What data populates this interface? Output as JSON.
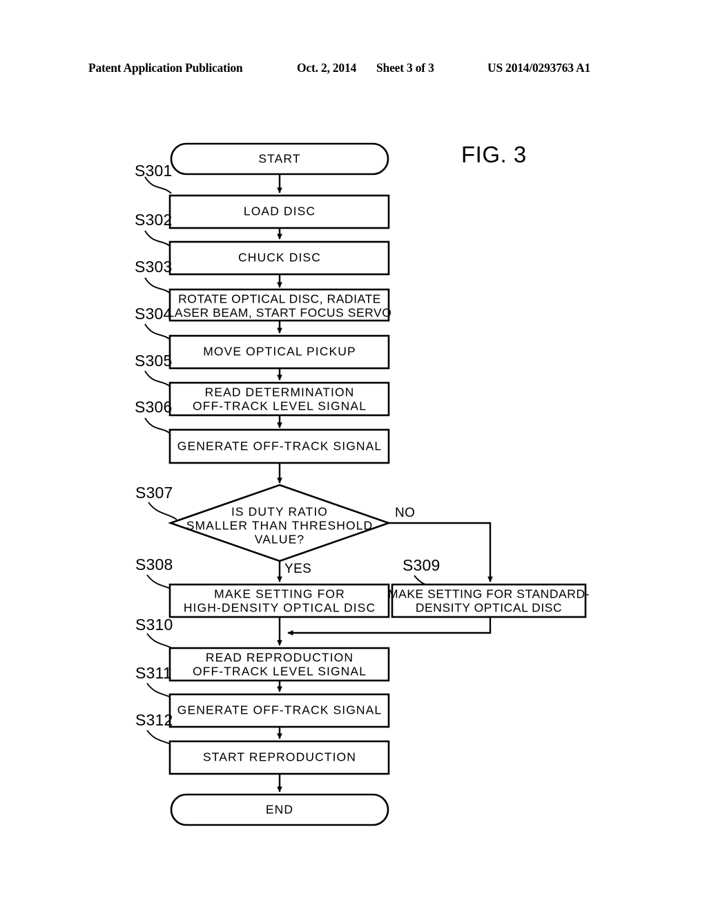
{
  "header": {
    "publication": "Patent Application Publication",
    "date": "Oct. 2, 2014",
    "sheet": "Sheet 3 of 3",
    "number": "US 2014/0293763 A1"
  },
  "figure": {
    "label": "FIG. 3"
  },
  "flowchart": {
    "nodes": [
      {
        "id": "S301",
        "step": "S301",
        "shape": "terminator",
        "lines": [
          "START"
        ]
      },
      {
        "id": "S302",
        "step": "S302",
        "shape": "process",
        "lines": [
          "LOAD DISC"
        ]
      },
      {
        "id": "S303",
        "step": "S303",
        "shape": "process",
        "lines": [
          "CHUCK  DISC"
        ]
      },
      {
        "id": "S304",
        "step": "S304",
        "shape": "process",
        "lines": [
          "ROTATE  OPTICAL  DISC,  RADIATE",
          "LASER  BEAM,  START  FOCUS  SERVO"
        ]
      },
      {
        "id": "S305",
        "step": "S305",
        "shape": "process",
        "lines": [
          "MOVE  OPTICAL  PICKUP"
        ]
      },
      {
        "id": "S306",
        "step": "S306",
        "shape": "process",
        "lines": [
          "READ  DETERMINATION",
          "OFF-TRACK  LEVEL  SIGNAL"
        ]
      },
      {
        "id": "S306b",
        "step": "",
        "shape": "process",
        "lines": [
          "GENERATE  OFF-TRACK  SIGNAL"
        ]
      },
      {
        "id": "S307",
        "step": "S307",
        "shape": "decision",
        "lines": [
          "IS  DUTY  RATIO",
          "SMALLER  THAN  THRESHOLD",
          "VALUE?"
        ]
      },
      {
        "id": "S308",
        "step": "S308",
        "shape": "process",
        "lines": [
          "MAKE  SETTING  FOR",
          "HIGH-DENSITY  OPTICAL  DISC"
        ]
      },
      {
        "id": "S309",
        "step": "S309",
        "shape": "process",
        "lines": [
          "MAKE  SETTING  FOR  STANDARD-",
          "DENSITY  OPTICAL  DISC"
        ]
      },
      {
        "id": "S310",
        "step": "S310",
        "shape": "process",
        "lines": [
          "READ  REPRODUCTION",
          "OFF-TRACK  LEVEL  SIGNAL"
        ]
      },
      {
        "id": "S311",
        "step": "S311",
        "shape": "process",
        "lines": [
          "GENERATE  OFF-TRACK  SIGNAL"
        ]
      },
      {
        "id": "S312",
        "step": "S312",
        "shape": "process",
        "lines": [
          "START  REPRODUCTION"
        ]
      },
      {
        "id": "END",
        "step": "",
        "shape": "terminator",
        "lines": [
          "END"
        ]
      }
    ],
    "branch_labels": {
      "yes": "YES",
      "no": "NO"
    },
    "step_labels": [
      "S301",
      "S302",
      "S303",
      "S304",
      "S305",
      "S306",
      "S307",
      "S308",
      "S309",
      "S310",
      "S311",
      "S312"
    ],
    "colors": {
      "ink": "#000000",
      "paper": "#ffffff"
    }
  }
}
